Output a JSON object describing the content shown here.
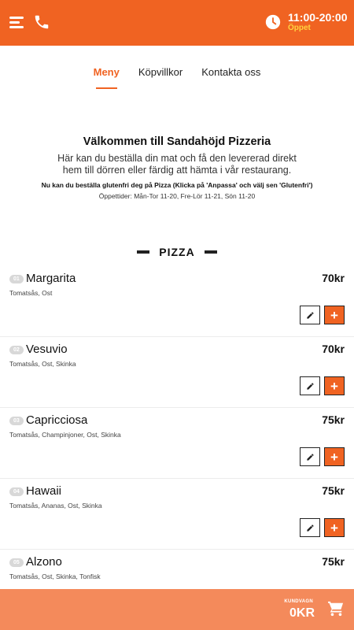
{
  "header": {
    "hours": "11:00-20:00",
    "status": "Öppet",
    "icons": [
      "menu-icon",
      "phone-icon",
      "clock-icon"
    ]
  },
  "tabs": [
    {
      "label": "Meny",
      "active": true
    },
    {
      "label": "Köpvillkor",
      "active": false
    },
    {
      "label": "Kontakta oss",
      "active": false
    }
  ],
  "welcome": {
    "title": "Välkommen till Sandahöjd Pizzeria",
    "description": "Här kan du beställa din mat och få den levererad direkt hem till dörren eller färdig att hämta i vår restaurang.",
    "gluten_note": "Nu kan du beställa glutenfri deg på Pizza (Klicka på 'Anpassa' och välj sen 'Glutenfri')",
    "opening_hours": "Öppettider: Mån-Tor 11-20, Fre-Lör 11-21, Sön 11-20"
  },
  "section": {
    "title": "PIZZA"
  },
  "items": [
    {
      "num": "01",
      "name": "Margarita",
      "ingredients": "Tomatsås, Ost",
      "price": "70kr"
    },
    {
      "num": "02",
      "name": "Vesuvio",
      "ingredients": "Tomatsås, Ost, Skinka",
      "price": "70kr"
    },
    {
      "num": "03",
      "name": "Capricciosa",
      "ingredients": "Tomatsås, Champinjoner, Ost, Skinka",
      "price": "75kr"
    },
    {
      "num": "04",
      "name": "Hawaii",
      "ingredients": "Tomatsås, Ananas, Ost, Skinka",
      "price": "75kr"
    },
    {
      "num": "05",
      "name": "Alzono",
      "ingredients": "Tomatsås, Ost, Skinka, Tonfisk",
      "price": "75kr"
    }
  ],
  "cart": {
    "label": "KUNDVAGN",
    "total": "0KR"
  },
  "colors": {
    "accent": "#f06322",
    "status": "#ffd23f",
    "cartbar": "#f48a5b"
  }
}
